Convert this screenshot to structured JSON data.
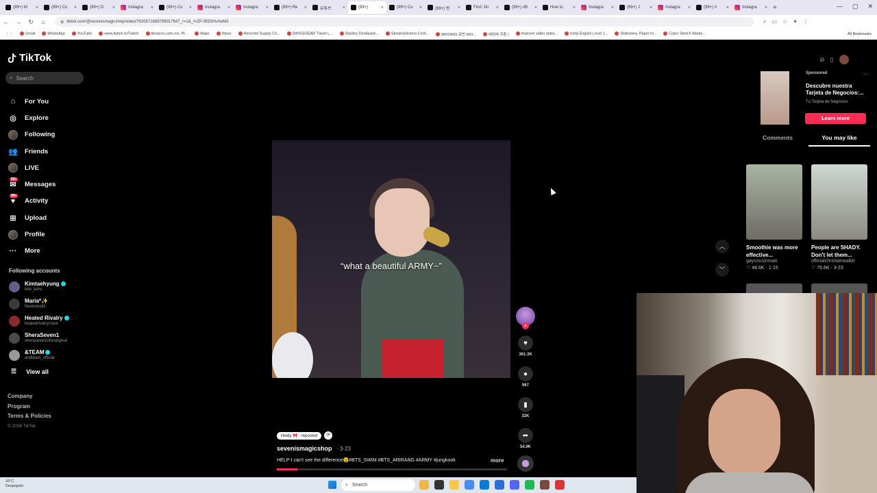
{
  "browser": {
    "tabs": [
      {
        "label": "(99+) M",
        "icon": "tiktok-icon",
        "active": false
      },
      {
        "label": "(99+) Co",
        "icon": "tiktok-icon",
        "active": false
      },
      {
        "label": "(99+) D",
        "icon": "tiktok-icon",
        "active": false
      },
      {
        "label": "Instagra",
        "icon": "instagram-icon",
        "active": false
      },
      {
        "label": "(99+) Co",
        "icon": "tiktok-icon",
        "active": false
      },
      {
        "label": "Instagra",
        "icon": "instagram-icon",
        "active": false
      },
      {
        "label": "Instagra",
        "icon": "instagram-icon",
        "active": false
      },
      {
        "label": "(99+) Re",
        "icon": "tiktok-icon",
        "active": false
      },
      {
        "label": "유튜브",
        "icon": "tiktok-icon",
        "active": false
      },
      {
        "label": "(99+) ",
        "icon": "tiktok-icon",
        "active": true
      },
      {
        "label": "(99+) Co",
        "icon": "tiktok-icon",
        "active": false
      },
      {
        "label": "(99+) 방",
        "icon": "tiktok-icon",
        "active": false
      },
      {
        "label": "Find 'Jin",
        "icon": "tiktok-icon",
        "active": false
      },
      {
        "label": "(99+) #B",
        "icon": "tiktok-icon",
        "active": false
      },
      {
        "label": "How to",
        "icon": "tiktok-icon",
        "active": false
      },
      {
        "label": "Instagra",
        "icon": "instagram-icon",
        "active": false
      },
      {
        "label": "(99+) J",
        "icon": "tiktok-icon",
        "active": false
      },
      {
        "label": "Instagra",
        "icon": "instagram-icon",
        "active": false
      },
      {
        "label": "(99+) #",
        "icon": "tiktok-icon",
        "active": false
      },
      {
        "label": "Instagra",
        "icon": "instagram-icon",
        "active": false
      }
    ],
    "url": "tiktok.com/@sevenismagicshop/video/7620671689789017647_r=1&_t=ZP-95DIHvAwM3",
    "bookmarks": [
      "Gmail",
      "WhatsApp",
      "YouTube",
      "www.twitch.tv/Twitch",
      "Amazon.com.mx: Pr...",
      "Maps",
      "News",
      "Herschel Supply Co...",
      "SWISSGEAR Travel L...",
      "Stanley Drinkware...",
      "StreamStickers Conf...",
      "WOOING 유빈 WO...",
      "네이버 쿠폰 I",
      "Improve video statis...",
      "Insta English Level 1...",
      "Stationery, Paper fo...",
      "Copic Sketch Marke..."
    ],
    "all_bookmarks": "All Bookmarks"
  },
  "sidebar": {
    "brand": "TikTok",
    "search_placeholder": "Search",
    "nav": [
      {
        "label": "For You",
        "icon": "home-icon",
        "badge": ""
      },
      {
        "label": "Explore",
        "icon": "compass-icon",
        "badge": ""
      },
      {
        "label": "Following",
        "icon": "following-avatar-icon",
        "badge": ""
      },
      {
        "label": "Friends",
        "icon": "friends-icon",
        "badge": ""
      },
      {
        "label": "LIVE",
        "icon": "live-icon",
        "badge": ""
      },
      {
        "label": "Messages",
        "icon": "messages-icon",
        "badge": "99+"
      },
      {
        "label": "Activity",
        "icon": "activity-icon",
        "badge": "99+"
      },
      {
        "label": "Upload",
        "icon": "upload-icon",
        "badge": ""
      },
      {
        "label": "Profile",
        "icon": "profile-avatar-icon",
        "badge": ""
      },
      {
        "label": "More",
        "icon": "more-icon",
        "badge": ""
      }
    ],
    "following_title": "Following accounts",
    "accounts": [
      {
        "name": "Kimtaehyung",
        "handle": "tete_kimv",
        "verified": true
      },
      {
        "name": "Maria*✨",
        "handle": "freelovestill",
        "verified": false
      },
      {
        "name": "Heated Rivalry",
        "handle": "heatedrivalrycrave",
        "verified": true
      },
      {
        "name": "SheraSeven1",
        "handle": "sheraseven1theoriginal",
        "verified": false
      },
      {
        "name": "&TEAM",
        "handle": "andteam_official",
        "verified": true
      }
    ],
    "view_all": "View all",
    "footer": [
      "Company",
      "Program",
      "Terms & Policies"
    ],
    "copyright": "© 2026 TikTok"
  },
  "video": {
    "overlay_caption": "“what a beautiful ARMY~”",
    "progress_fraction": 0.09,
    "repost_label": "Heidy 🎀 · reposted",
    "author": "sevenismagicshop",
    "date": "· 3-23",
    "description": "HELP-I can't see the difference😵#BTS_SWIM #BTS_ARIRANG #ARMY #jungkook",
    "more": "more",
    "stats": {
      "likes": "361.3K",
      "comments": "967",
      "saves": "32K",
      "shares": "54.9K"
    }
  },
  "right_panel": {
    "ad": {
      "sponsored": "Sponsored",
      "title": "Descubre nuestra Tarjeta de Negocios:...",
      "subtitle": "Tu Tarjeta de Negocios",
      "cta": "Learn more"
    },
    "tabs": [
      "Comments",
      "You may like"
    ],
    "active_tab": "You may like",
    "recommendations": [
      {
        "title": "Smoothie was more effective...",
        "author": "gaycousinmatt",
        "likes": "48.6K",
        "date": "1-15"
      },
      {
        "title": "People are SHADY. Don't let them...",
        "author": "officialchristianwalktr",
        "likes": "76.6K",
        "date": "3-23"
      }
    ]
  },
  "taskbar": {
    "weather_temp": "16°C",
    "weather_desc": "Despejado",
    "search": "Search"
  },
  "colors": {
    "accent": "#fe2c55",
    "verified": "#20d5ec",
    "background": "#000000"
  }
}
